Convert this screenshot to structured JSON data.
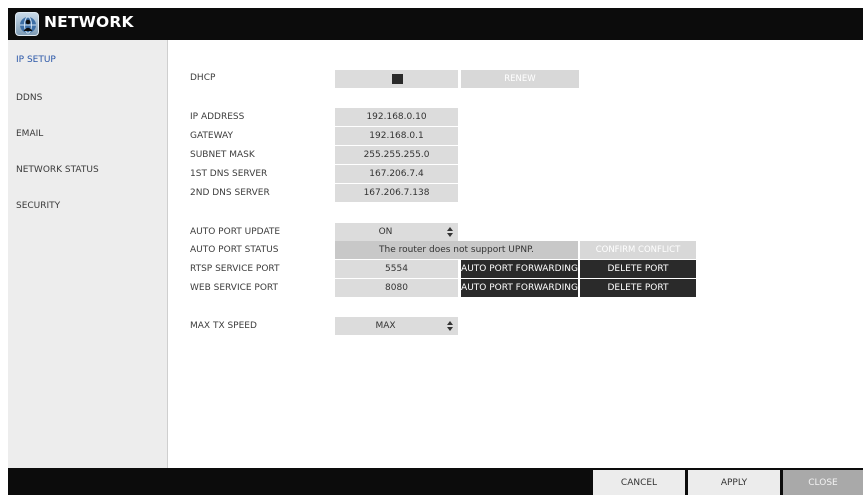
{
  "window": {
    "title": "NETWORK",
    "logo_icon": "network-globe-icon"
  },
  "sidebar": {
    "items": [
      {
        "label": "IP SETUP",
        "active": true
      },
      {
        "label": "DDNS"
      },
      {
        "label": "EMAIL"
      },
      {
        "label": "NETWORK STATUS"
      },
      {
        "label": "SECURITY"
      }
    ]
  },
  "ip_setup": {
    "dhcp_label": "DHCP",
    "dhcp_checked": true,
    "renew_label": "RENEW",
    "ip_address_label": "IP ADDRESS",
    "ip_address": "192.168.0.10",
    "gateway_label": "GATEWAY",
    "gateway": "192.168.0.1",
    "subnet_mask_label": "SUBNET MASK",
    "subnet_mask": "255.255.255.0",
    "dns1_label": "1ST DNS SERVER",
    "dns1": "167.206.7.4",
    "dns2_label": "2ND DNS SERVER",
    "dns2": "167.206.7.138",
    "auto_port_update_label": "AUTO PORT UPDATE",
    "auto_port_update": "ON",
    "auto_port_status_label": "AUTO PORT STATUS",
    "auto_port_status": "The router does not support UPNP.",
    "confirm_conflict_label": "CONFIRM CONFLICT",
    "rtsp_label": "RTSP SERVICE PORT",
    "rtsp_port": "5554",
    "web_label": "WEB SERVICE PORT",
    "web_port": "8080",
    "auto_port_forwarding_label": "AUTO PORT FORWARDING",
    "delete_port_label": "DELETE PORT",
    "max_tx_speed_label": "MAX TX SPEED",
    "max_tx_speed": "MAX"
  },
  "footer": {
    "cancel_label": "CANCEL",
    "apply_label": "APPLY",
    "close_label": "CLOSE"
  },
  "colors": {
    "titlebar": "#0c0c0c",
    "sidebar_bg": "#ededed",
    "active_item": "#2a57a8",
    "field_bg": "#dcdcdc",
    "dark_button": "#2a2a2a"
  }
}
